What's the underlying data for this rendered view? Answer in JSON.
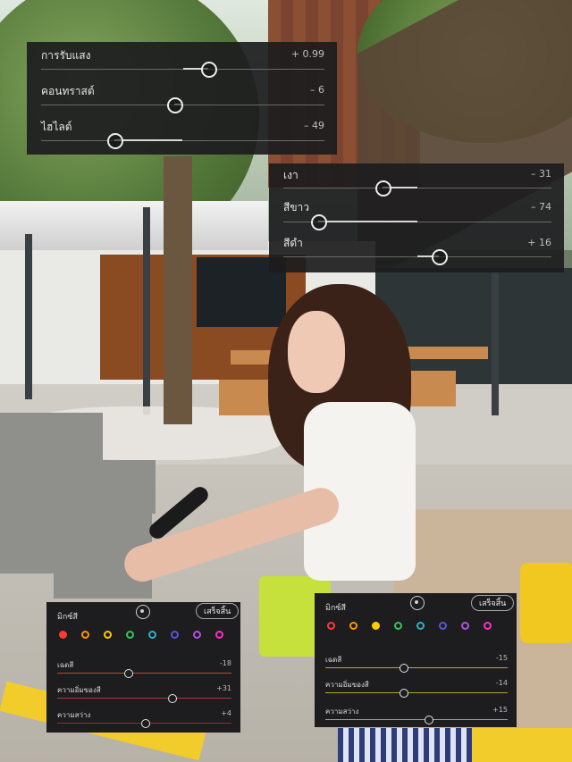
{
  "light_panel": {
    "sliders": [
      {
        "label": "การรับแสง",
        "value": "+ 0.99",
        "level": 0.59
      },
      {
        "label": "คอนทราสต์",
        "value": "– 6",
        "level": 0.47
      },
      {
        "label": "ไฮไลต์",
        "value": "– 49",
        "level": 0.26
      }
    ]
  },
  "tone_panel": {
    "sliders": [
      {
        "label": "เงา",
        "value": "– 31",
        "level": 0.37
      },
      {
        "label": "สีขาว",
        "value": "– 74",
        "level": 0.13
      },
      {
        "label": "สีดำ",
        "value": "+ 16",
        "level": 0.58
      }
    ]
  },
  "mixer_left": {
    "title": "มิกซ์สี",
    "done_label": "เสร็จสิ้น",
    "colors": [
      "#ff3b30",
      "#ff9500",
      "#ffcc00",
      "#34c759",
      "#30b0c7",
      "#5856d6",
      "#af52de",
      "#ff2dc8"
    ],
    "active_index": 0,
    "sliders": [
      {
        "label": "เฉดสี",
        "value": "-18",
        "level": 0.41,
        "track": "#c0423e"
      },
      {
        "label": "ความอิ่มของสี",
        "value": "+31",
        "level": 0.66,
        "track": "#b13a36"
      },
      {
        "label": "ความสว่าง",
        "value": "+4",
        "level": 0.51,
        "track": "#8e2f2c"
      }
    ]
  },
  "mixer_right": {
    "title": "มิกซ์สี",
    "done_label": "เสร็จสิ้น",
    "colors": [
      "#ff3b30",
      "#ff9500",
      "#ffcc00",
      "#34c759",
      "#30b0c7",
      "#5856d6",
      "#af52de",
      "#ff2dc8"
    ],
    "active_index": 2,
    "sliders": [
      {
        "label": "เฉดสี",
        "value": "-15",
        "level": 0.43,
        "track": "#b6a833"
      },
      {
        "label": "ความอิ่มของสี",
        "value": "-14",
        "level": 0.43,
        "track": "#b3a42f"
      },
      {
        "label": "ความสว่าง",
        "value": "+15",
        "level": 0.57,
        "track": "#9c9a8f"
      }
    ]
  }
}
